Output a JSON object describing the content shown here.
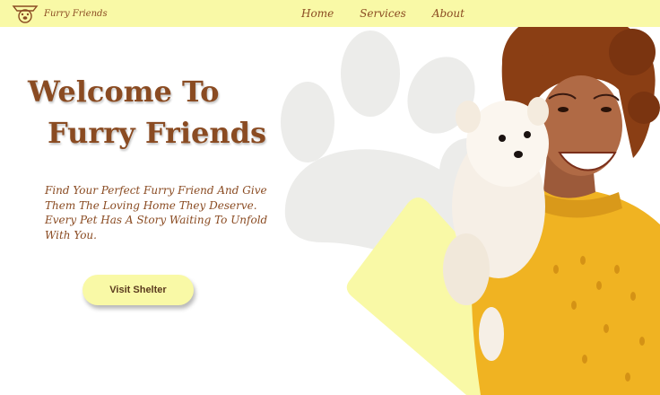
{
  "nav": {
    "brand": "Furry Friends",
    "brand_icon": "paw-badge-icon",
    "links": [
      {
        "label": "Home"
      },
      {
        "label": "Services"
      },
      {
        "label": "About"
      }
    ]
  },
  "hero": {
    "title_line1": "Welcome To",
    "title_line2": "Furry Friends",
    "description": "Find Your Perfect Furry Friend And Give Them The Loving Home They Deserve. Every Pet Has A Story Waiting To Unfold With You.",
    "button_label": "Visit Shelter",
    "decor_icon": "paw-print-icon"
  },
  "colors": {
    "accent": "#f9f9a6",
    "brand_brown": "#8a4b22",
    "paw_gray": "#ececea",
    "sweater": "#f0b322"
  }
}
